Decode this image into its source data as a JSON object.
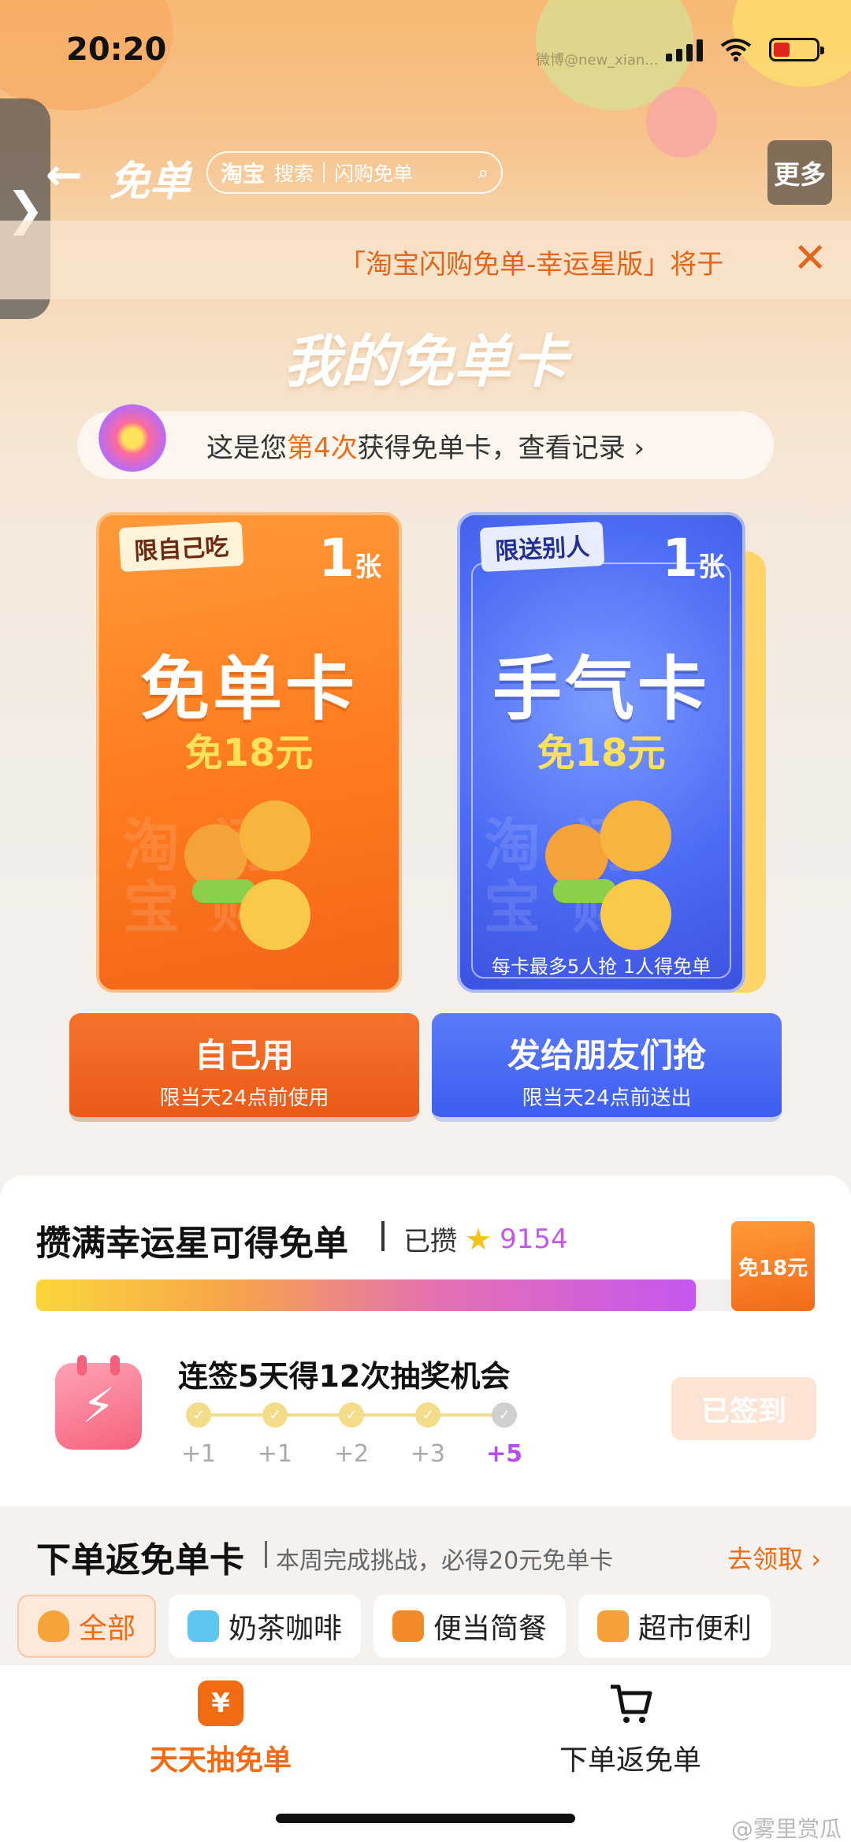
{
  "status_bar": {
    "time": "20:20",
    "watermark": "微博@new_xian..."
  },
  "nav": {
    "side_tab_glyph": "❯",
    "back_glyph": "←",
    "title": "免单",
    "search": {
      "brand": "淘宝",
      "label": "搜索",
      "placeholder": "闪购免单",
      "icon": "⌕"
    },
    "more_label": "更多"
  },
  "notice": {
    "text": "「淘宝闪购免单-幸运星版」将于",
    "close_glyph": "✕"
  },
  "heading": "我的免单卡",
  "record": {
    "prefix": "这是您",
    "highlight": "第4次",
    "suffix": "获得免单卡，查看记录 ›"
  },
  "cards": [
    {
      "tag": "限自己吃",
      "count": "1",
      "unit": "张",
      "name": "免单卡",
      "value": "免18元",
      "watermark": "淘闪 宝购",
      "note": ""
    },
    {
      "tag": "限送别人",
      "count": "1",
      "unit": "张",
      "name": "手气卡",
      "value": "免18元",
      "watermark": "淘闪 宝购",
      "note": "每卡最多5人抢 1人得免单"
    }
  ],
  "actions": {
    "self": {
      "label": "自己用",
      "sub": "限当天24点前使用"
    },
    "friends": {
      "label": "发给朋友们抢",
      "sub": "限当天24点前送出"
    }
  },
  "lucky": {
    "title": "攒满幸运星可得免单",
    "collected_label": "已攒",
    "collected_value": "9154",
    "progress_fraction": 0.93,
    "reward": "免18元"
  },
  "checkin": {
    "title": "连签5天得12次抽奖机会",
    "days": [
      {
        "reward": "+1",
        "done": true
      },
      {
        "reward": "+1",
        "done": true
      },
      {
        "reward": "+2",
        "done": true
      },
      {
        "reward": "+3",
        "done": true
      },
      {
        "reward": "+5",
        "done": false
      }
    ],
    "button_label": "已签到"
  },
  "returns": {
    "title": "下单返免单卡",
    "subtitle": "本周完成挑战，必得20元免单卡",
    "link": "去领取 ›",
    "categories": [
      "全部",
      "奶茶咖啡",
      "便当简餐",
      "超市便利"
    ]
  },
  "tabbar": {
    "tabs": [
      {
        "label": "天天抽免单",
        "icon": "¥"
      },
      {
        "label": "下单返免单",
        "icon": "🛒"
      }
    ]
  },
  "footer_watermark": "@雾里赏瓜",
  "colors": {
    "accent": "#f26a12",
    "blue": "#3e5df0",
    "purple": "#c457f0"
  }
}
